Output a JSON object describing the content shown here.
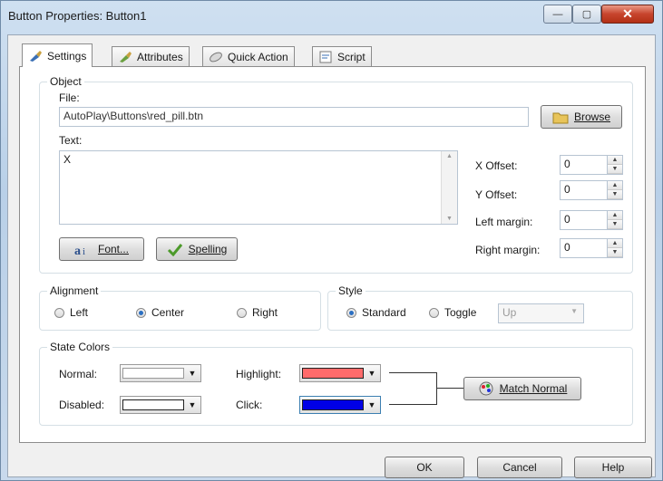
{
  "window": {
    "title": "Button Properties: Button1",
    "min_label": "—",
    "max_label": "▢",
    "close_label": "✕"
  },
  "tabs": [
    {
      "label": "Settings",
      "icon": "brush-icon"
    },
    {
      "label": "Attributes",
      "icon": "brush-icon"
    },
    {
      "label": "Quick Action",
      "icon": "lens-icon"
    },
    {
      "label": "Script",
      "icon": "script-icon"
    }
  ],
  "object": {
    "group_label": "Object",
    "file_label": "File:",
    "file_value": "AutoPlay\\Buttons\\red_pill.btn",
    "browse_label": "Browse",
    "text_label": "Text:",
    "text_value": "X",
    "font_label": "Font...",
    "spelling_label": "Spelling",
    "x_offset_label": "X Offset:",
    "x_offset": "0",
    "y_offset_label": "Y Offset:",
    "y_offset": "0",
    "left_margin_label": "Left margin:",
    "left_margin": "0",
    "right_margin_label": "Right margin:",
    "right_margin": "0"
  },
  "alignment": {
    "group_label": "Alignment",
    "options": [
      "Left",
      "Center",
      "Right"
    ],
    "selected": "Center"
  },
  "style": {
    "group_label": "Style",
    "options": [
      "Standard",
      "Toggle"
    ],
    "selected": "Standard",
    "toggle_state": "Up"
  },
  "state_colors": {
    "group_label": "State Colors",
    "normal_label": "Normal:",
    "normal_color": "#ffffff",
    "highlight_label": "Highlight:",
    "highlight_color": "#ff6b6b",
    "disabled_label": "Disabled:",
    "disabled_color": "#ffffff",
    "click_label": "Click:",
    "click_color": "#0000e6",
    "match_normal_label": "Match Normal"
  },
  "footer": {
    "ok": "OK",
    "cancel": "Cancel",
    "help": "Help"
  }
}
